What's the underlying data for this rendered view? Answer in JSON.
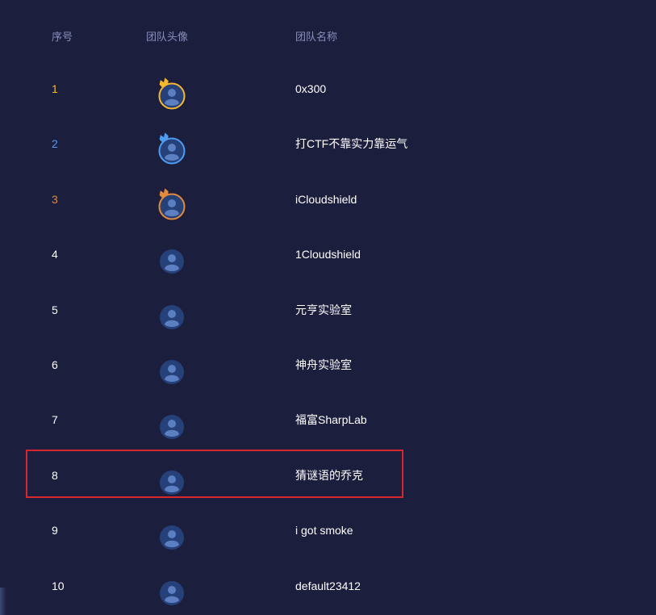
{
  "header": {
    "rank_label": "序号",
    "avatar_label": "团队头像",
    "name_label": "团队名称"
  },
  "colors": {
    "background": "#1c1e3d",
    "header_text": "#8a8fbd",
    "gold": "#f5b82e",
    "silver_blue": "#4f9cf2",
    "bronze": "#e38a3b",
    "highlight_border": "#d8262c"
  },
  "rows": [
    {
      "rank": "1",
      "name": "0x300",
      "medal": "gold"
    },
    {
      "rank": "2",
      "name": "打CTF不靠实力靠运气",
      "medal": "silver"
    },
    {
      "rank": "3",
      "name": "iCloudshield",
      "medal": "bronze"
    },
    {
      "rank": "4",
      "name": "1Cloudshield",
      "medal": "none"
    },
    {
      "rank": "5",
      "name": "元亨实验室",
      "medal": "none"
    },
    {
      "rank": "6",
      "name": "神舟实验室",
      "medal": "none"
    },
    {
      "rank": "7",
      "name": "福富SharpLab",
      "medal": "none"
    },
    {
      "rank": "8",
      "name": "猜谜语的乔克",
      "medal": "none",
      "highlighted": true
    },
    {
      "rank": "9",
      "name": "i got smoke",
      "medal": "none"
    },
    {
      "rank": "10",
      "name": "default23412",
      "medal": "none"
    }
  ]
}
